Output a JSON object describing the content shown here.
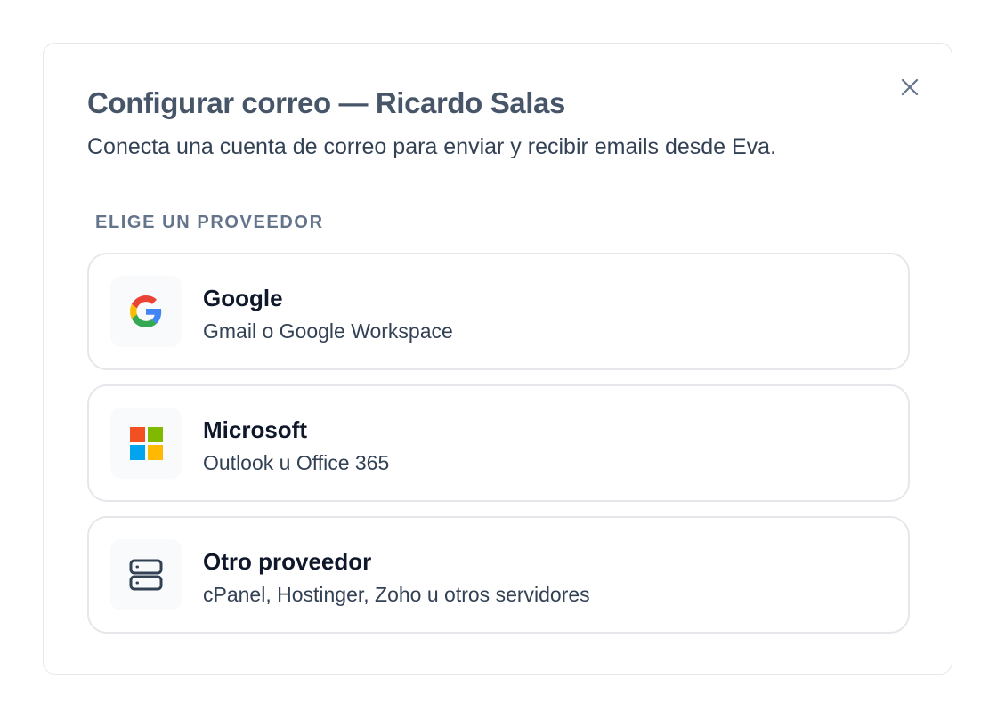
{
  "dialog": {
    "title": "Configurar correo — Ricardo Salas",
    "subtitle": "Conecta una cuenta de correo para enviar y recibir emails desde Eva.",
    "close_icon": "close-icon"
  },
  "section": {
    "label": "ELIGE UN PROVEEDOR"
  },
  "providers": [
    {
      "name": "Google",
      "description": "Gmail o Google Workspace",
      "icon": "google-logo-icon"
    },
    {
      "name": "Microsoft",
      "description": "Outlook u Office 365",
      "icon": "microsoft-logo-icon"
    },
    {
      "name": "Otro proveedor",
      "description": "cPanel, Hostinger, Zoho u otros servidores",
      "icon": "server-icon"
    }
  ],
  "colors": {
    "title": "#475569",
    "border": "#e5e7eb",
    "google_blue": "#4285F4",
    "google_red": "#EA4335",
    "google_yellow": "#FBBC05",
    "google_green": "#34A853",
    "ms_red": "#F25022",
    "ms_green": "#7FBA00",
    "ms_blue": "#00A4EF",
    "ms_yellow": "#FFB900"
  }
}
